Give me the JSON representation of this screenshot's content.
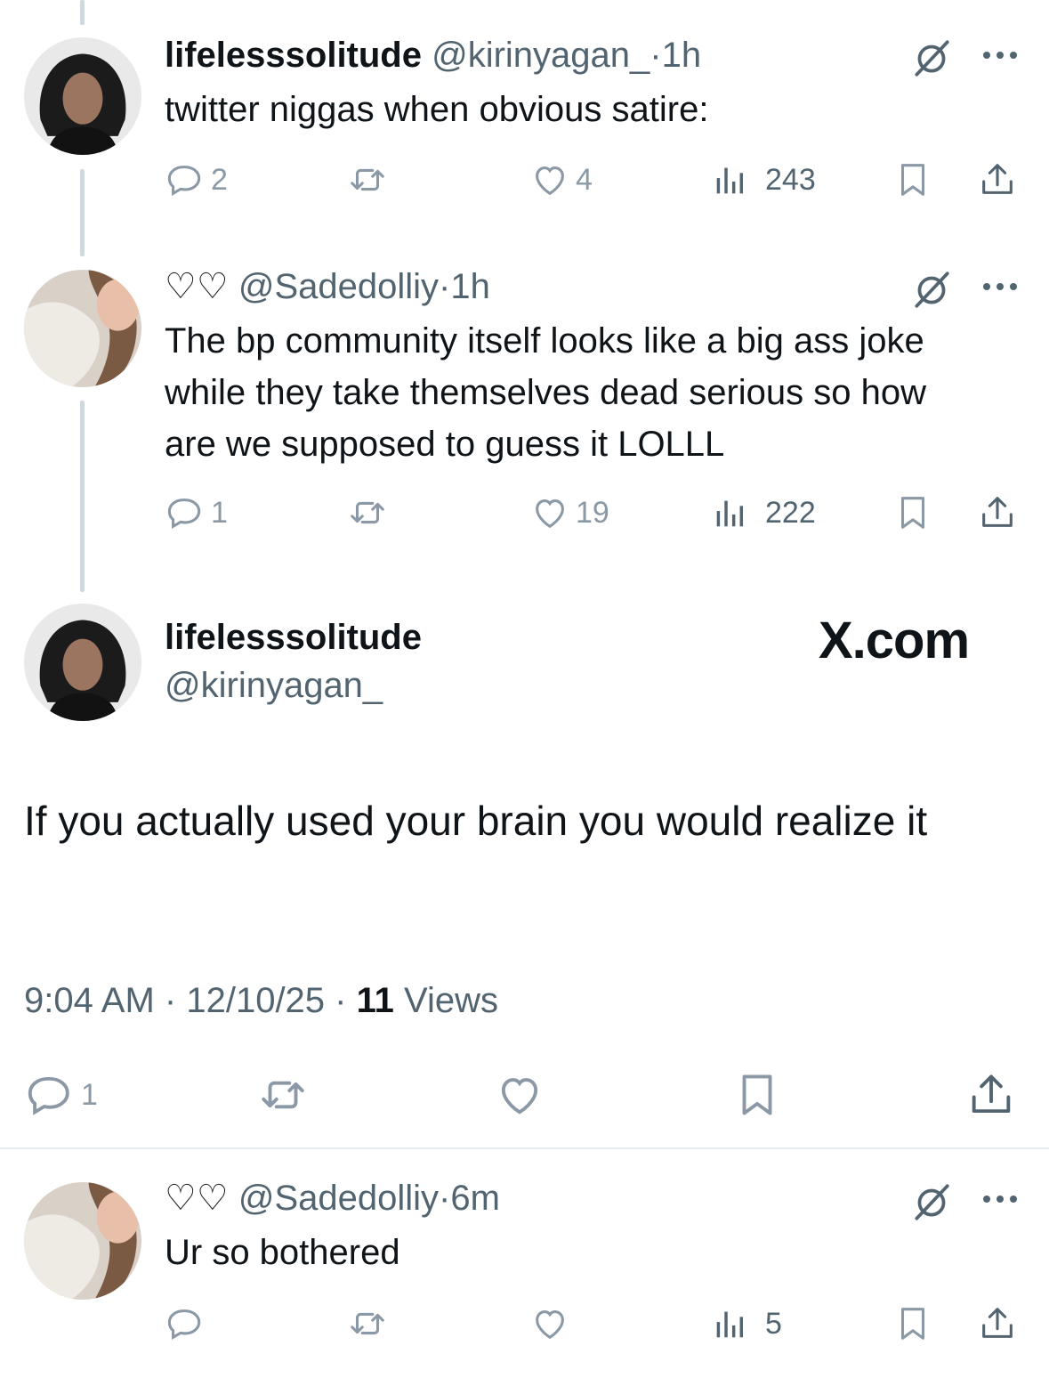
{
  "tweets": [
    {
      "name": "lifelesssolitude",
      "handle": "@kirinyagan_",
      "separator": "·",
      "time": "1h",
      "text": "twitter niggas when obvious satire:",
      "replies": "2",
      "likes": "4",
      "views": "243"
    },
    {
      "name": "♡♡",
      "handle": "@Sadedolliy",
      "separator": "·",
      "time": "1h",
      "text": "The bp community itself looks like a big ass joke while they take themselves dead serious so how are we supposed to guess it LOLLL",
      "replies": "1",
      "likes": "19",
      "views": "222"
    }
  ],
  "focused": {
    "name": "lifelesssolitude",
    "handle": "@kirinyagan_",
    "watermark": "X.com",
    "text": "If you actually used your brain you would realize it",
    "time": "9:04 AM",
    "date": "12/10/25",
    "separator": "·",
    "views_count": "11",
    "views_label": "Views",
    "replies": "1"
  },
  "reply": {
    "name": "♡♡",
    "handle": "@Sadedolliy",
    "separator": "·",
    "time": "6m",
    "text": "Ur so bothered",
    "views": "5"
  },
  "icons": [
    "reply-icon",
    "retweet-icon",
    "like-icon",
    "views-icon",
    "bookmark-icon",
    "share-icon",
    "grok-icon",
    "more-icon"
  ],
  "colors": {
    "text": "#0f1419",
    "muted": "#536471",
    "light_icon": "#8b98a5",
    "thread_line": "#cfd9de"
  }
}
